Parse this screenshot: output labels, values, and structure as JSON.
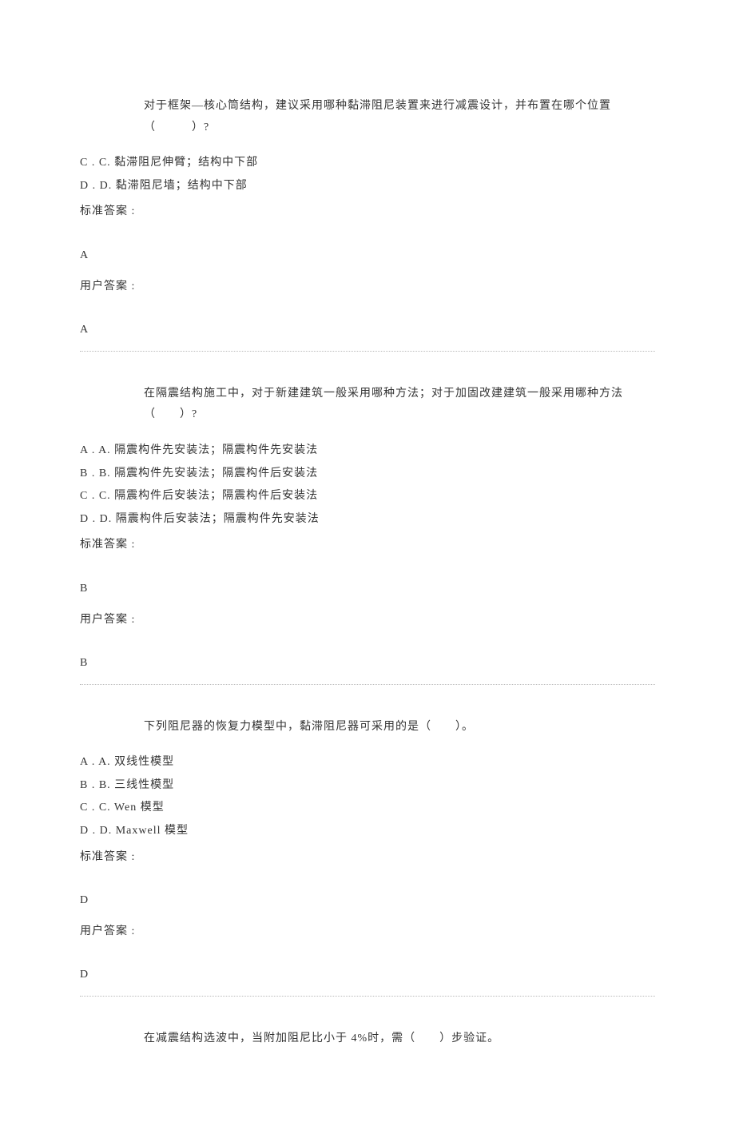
{
  "q1": {
    "question": "对于框架—核心筒结构，建议采用哪种黏滞阻尼装置来进行减震设计，并布置在哪个位置（　　　）?",
    "optionC": "C . C. 黏滞阻尼伸臂；结构中下部",
    "optionD": "D . D. 黏滞阻尼墙；结构中下部",
    "stdLabel": "标准答案 :",
    "stdAnswer": "A",
    "userLabel": "用户答案 :",
    "userAnswer": "A"
  },
  "q2": {
    "question": "在隔震结构施工中，对于新建建筑一般采用哪种方法；对于加固改建建筑一般采用哪种方法（　　）?",
    "optionA": "A . A. 隔震构件先安装法；隔震构件先安装法",
    "optionB": "B . B. 隔震构件先安装法；隔震构件后安装法",
    "optionC": "C . C. 隔震构件后安装法；隔震构件后安装法",
    "optionD": "D . D. 隔震构件后安装法；隔震构件先安装法",
    "stdLabel": "标准答案 :",
    "stdAnswer": "B",
    "userLabel": "用户答案 :",
    "userAnswer": "B"
  },
  "q3": {
    "question": "下列阻尼器的恢复力模型中，黏滞阻尼器可采用的是（　　）。",
    "optionA": "A . A. 双线性模型",
    "optionB": "B . B. 三线性模型",
    "optionC": "C . C. Wen 模型",
    "optionD": "D . D. Maxwell 模型",
    "stdLabel": "标准答案 :",
    "stdAnswer": "D",
    "userLabel": "用户答案 :",
    "userAnswer": "D"
  },
  "q4": {
    "question": "在减震结构选波中，当附加阻尼比小于 4%时，需（　　）步验证。"
  }
}
